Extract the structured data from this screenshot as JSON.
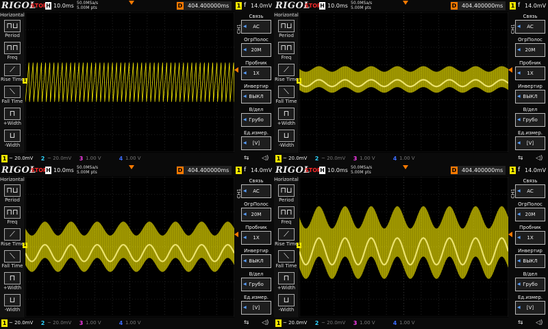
{
  "panels": [
    {
      "brand": "RIGOL",
      "status": "STOP",
      "h_label": "H",
      "h_scale": "10.0ms",
      "sample_rate": "50.0MSa/s",
      "mem_depth": "5.00M pts",
      "d_label": "D",
      "delay": "404.400000ms",
      "trig_channel": "1",
      "trig_edge": "f",
      "trig_level": "14.0mV",
      "left_menu": {
        "title": "Horizontal",
        "items": [
          {
            "label": "Period",
            "icon": "period-icon"
          },
          {
            "label": "Freq",
            "icon": "freq-icon"
          },
          {
            "label": "Rise Time",
            "icon": "rise-time-icon"
          },
          {
            "label": "Fall Time",
            "icon": "fall-time-icon"
          },
          {
            "label": "+Width",
            "icon": "pos-width-icon"
          },
          {
            "label": "-Width",
            "icon": "neg-width-icon"
          }
        ]
      },
      "ch_tag": "CH1",
      "right_menu": [
        {
          "label": "Связь",
          "value": "AC"
        },
        {
          "label": "ОгрПолос",
          "value": "20M"
        },
        {
          "label": "Пробник",
          "value": "1X"
        },
        {
          "label": "Инвертир",
          "value": "ВЫКЛ"
        },
        {
          "label": "В/дел",
          "value": "Грубо"
        },
        {
          "label": "Ед.измер.",
          "value": "[V]"
        }
      ],
      "channels": [
        {
          "num": "1",
          "value": "20.0mV",
          "color": "#f3e600"
        },
        {
          "num": "2",
          "value": "20.0mV",
          "color": "#2fd3ff"
        },
        {
          "num": "3",
          "value": "1.00 V",
          "color": "#ff3df0"
        },
        {
          "num": "4",
          "value": "1.00 V",
          "color": "#3c6dff"
        }
      ],
      "ch_coupling_symbol": "~",
      "wave": {
        "type": "sawtooth",
        "center": 0.5,
        "band": 0.28,
        "envelope": 0.0,
        "periods": 50
      }
    },
    {
      "brand": "RIGOL",
      "status": "STOP",
      "h_label": "H",
      "h_scale": "10.0ms",
      "sample_rate": "50.0MSa/s",
      "mem_depth": "5.00M pts",
      "d_label": "D",
      "delay": "404.400000ms",
      "trig_channel": "1",
      "trig_edge": "f",
      "trig_level": "14.0mV",
      "left_menu": {
        "title": "Horizontal",
        "items": [
          {
            "label": "Period",
            "icon": "period-icon"
          },
          {
            "label": "Freq",
            "icon": "freq-icon"
          },
          {
            "label": "Rise Time",
            "icon": "rise-time-icon"
          },
          {
            "label": "Fall Time",
            "icon": "fall-time-icon"
          },
          {
            "label": "+Width",
            "icon": "pos-width-icon"
          },
          {
            "label": "-Width",
            "icon": "neg-width-icon"
          }
        ]
      },
      "ch_tag": "CH1",
      "right_menu": [
        {
          "label": "Связь",
          "value": "AC"
        },
        {
          "label": "ОгрПолос",
          "value": "20M"
        },
        {
          "label": "Пробник",
          "value": "1X"
        },
        {
          "label": "Инвертир",
          "value": "ВЫКЛ"
        },
        {
          "label": "В/дел",
          "value": "Грубо"
        },
        {
          "label": "Ед.измер.",
          "value": "[V]"
        }
      ],
      "channels": [
        {
          "num": "1",
          "value": "20.0mV",
          "color": "#f3e600"
        },
        {
          "num": "2",
          "value": "20.0mV",
          "color": "#2fd3ff"
        },
        {
          "num": "3",
          "value": "1.00 V",
          "color": "#ff3df0"
        },
        {
          "num": "4",
          "value": "1.00 V",
          "color": "#3c6dff"
        }
      ],
      "ch_coupling_symbol": "~",
      "wave": {
        "type": "band",
        "center": 0.48,
        "band": 0.15,
        "envelope": 0.02,
        "periods": 8
      }
    },
    {
      "brand": "RIGOL",
      "status": "STOP",
      "h_label": "H",
      "h_scale": "10.0ms",
      "sample_rate": "50.0MSa/s",
      "mem_depth": "5.00M pts",
      "d_label": "D",
      "delay": "404.400000ms",
      "trig_channel": "1",
      "trig_edge": "f",
      "trig_level": "14.0mV",
      "left_menu": {
        "title": "Horizontal",
        "items": [
          {
            "label": "Period",
            "icon": "period-icon"
          },
          {
            "label": "Freq",
            "icon": "freq-icon"
          },
          {
            "label": "Rise Time",
            "icon": "rise-time-icon"
          },
          {
            "label": "Fall Time",
            "icon": "fall-time-icon"
          },
          {
            "label": "+Width",
            "icon": "pos-width-icon"
          },
          {
            "label": "-Width",
            "icon": "neg-width-icon"
          }
        ]
      },
      "ch_tag": "CH1",
      "right_menu": [
        {
          "label": "Связь",
          "value": "AC"
        },
        {
          "label": "ОгрПолос",
          "value": "20M"
        },
        {
          "label": "Пробник",
          "value": "1X"
        },
        {
          "label": "Инвертир",
          "value": "ВЫКЛ"
        },
        {
          "label": "В/дел",
          "value": "Грубо"
        },
        {
          "label": "Ед.измер.",
          "value": "[V]"
        }
      ],
      "channels": [
        {
          "num": "1",
          "value": "20.0mV",
          "color": "#f3e600"
        },
        {
          "num": "2",
          "value": "20.0mV",
          "color": "#2fd3ff"
        },
        {
          "num": "3",
          "value": "1.00 V",
          "color": "#ff3df0"
        },
        {
          "num": "4",
          "value": "1.00 V",
          "color": "#3c6dff"
        }
      ],
      "ch_coupling_symbol": "~",
      "wave": {
        "type": "band",
        "center": 0.5,
        "band": 0.26,
        "envelope": 0.05,
        "periods": 8
      }
    },
    {
      "brand": "RIGOL",
      "status": "STOP",
      "h_label": "H",
      "h_scale": "10.0ms",
      "sample_rate": "50.0MSa/s",
      "mem_depth": "5.00M pts",
      "d_label": "D",
      "delay": "404.400000ms",
      "trig_channel": "1",
      "trig_edge": "f",
      "trig_level": "14.0mV",
      "left_menu": {
        "title": "Horizontal",
        "items": [
          {
            "label": "Period",
            "icon": "period-icon"
          },
          {
            "label": "Freq",
            "icon": "freq-icon"
          },
          {
            "label": "Rise Time",
            "icon": "rise-time-icon"
          },
          {
            "label": "Fall Time",
            "icon": "fall-time-icon"
          },
          {
            "label": "+Width",
            "icon": "pos-width-icon"
          },
          {
            "label": "-Width",
            "icon": "neg-width-icon"
          }
        ]
      },
      "ch_tag": "CH1",
      "right_menu": [
        {
          "label": "Связь",
          "value": "AC"
        },
        {
          "label": "ОгрПолос",
          "value": "20M"
        },
        {
          "label": "Пробник",
          "value": "1X"
        },
        {
          "label": "Инвертир",
          "value": "ВЫКЛ"
        },
        {
          "label": "В/дел",
          "value": "Грубо"
        },
        {
          "label": "Ед.измер.",
          "value": "[V]"
        }
      ],
      "channels": [
        {
          "num": "1",
          "value": "20.0mV",
          "color": "#f3e600"
        },
        {
          "num": "2",
          "value": "20.0mV",
          "color": "#2fd3ff"
        },
        {
          "num": "3",
          "value": "1.00 V",
          "color": "#ff3df0"
        },
        {
          "num": "4",
          "value": "1.00 V",
          "color": "#3c6dff"
        }
      ],
      "ch_coupling_symbol": "~",
      "wave": {
        "type": "band",
        "center": 0.47,
        "band": 0.36,
        "envelope": 0.08,
        "periods": 8
      }
    }
  ],
  "colors": {
    "trace": "#f3e600",
    "trigger": "#ff7a00",
    "grid": "#3a3a3a",
    "stop": "#ff2a2a"
  }
}
